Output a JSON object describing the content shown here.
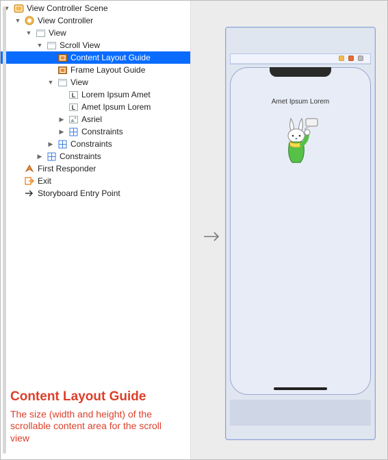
{
  "tree": {
    "r0": "View Controller Scene",
    "r1": "View Controller",
    "r2": "View",
    "r3": "Scroll View",
    "r4": "Content Layout Guide",
    "r5": "Frame Layout Guide",
    "r6": "View",
    "r7": "Lorem Ipsum Amet",
    "r8": "Amet Ipsum Lorem",
    "r9": "Asriel",
    "r10": "Constraints",
    "r11": "Constraints",
    "r12": "Constraints",
    "r13": "First Responder",
    "r14": "Exit",
    "r15": "Storyboard Entry Point"
  },
  "annotation": {
    "title": "Content Layout Guide",
    "desc": "The size (width and height) of the scrollable content area for the scroll view"
  },
  "canvas": {
    "screen_text": "Amet Ipsum Lorem"
  }
}
